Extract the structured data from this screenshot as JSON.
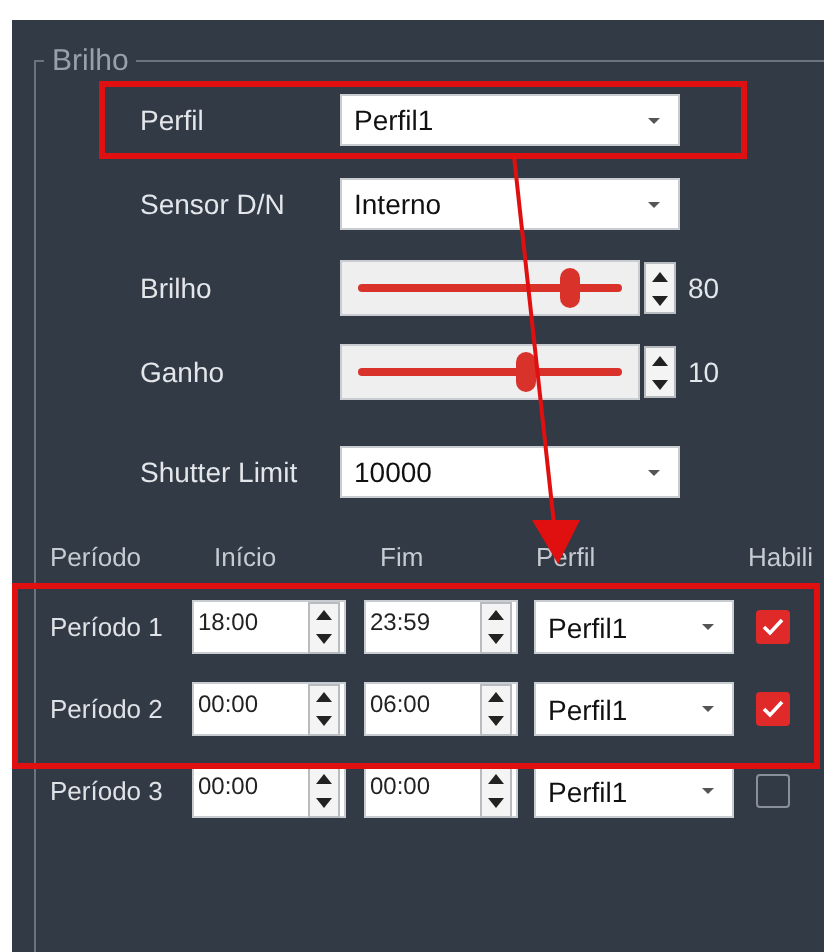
{
  "group": {
    "title": "Brilho"
  },
  "settings": [
    {
      "kind": "dropdown",
      "label": "Perfil",
      "value": "Perfil1"
    },
    {
      "kind": "dropdown",
      "label": "Sensor D/N",
      "value": "Interno"
    },
    {
      "kind": "slider",
      "label": "Brilho",
      "level": 0.8,
      "reading": "80"
    },
    {
      "kind": "slider",
      "label": "Ganho",
      "level": 0.64,
      "reading": "10"
    },
    {
      "kind": "dropdown",
      "label": "Shutter Limit",
      "value": "10000"
    }
  ],
  "schedule": {
    "columns": [
      "Período",
      "Início",
      "Fim",
      "Perfil",
      "Habili"
    ],
    "rows": [
      {
        "name": "Período 1",
        "start": "18:00",
        "end": "23:59",
        "profile": "Perfil1",
        "checked": true
      },
      {
        "name": "Período 2",
        "start": "00:00",
        "end": "06:00",
        "profile": "Perfil1",
        "checked": true
      },
      {
        "name": "Período 3",
        "start": "00:00",
        "end": "00:00",
        "profile": "Perfil1",
        "checked": false
      }
    ]
  }
}
